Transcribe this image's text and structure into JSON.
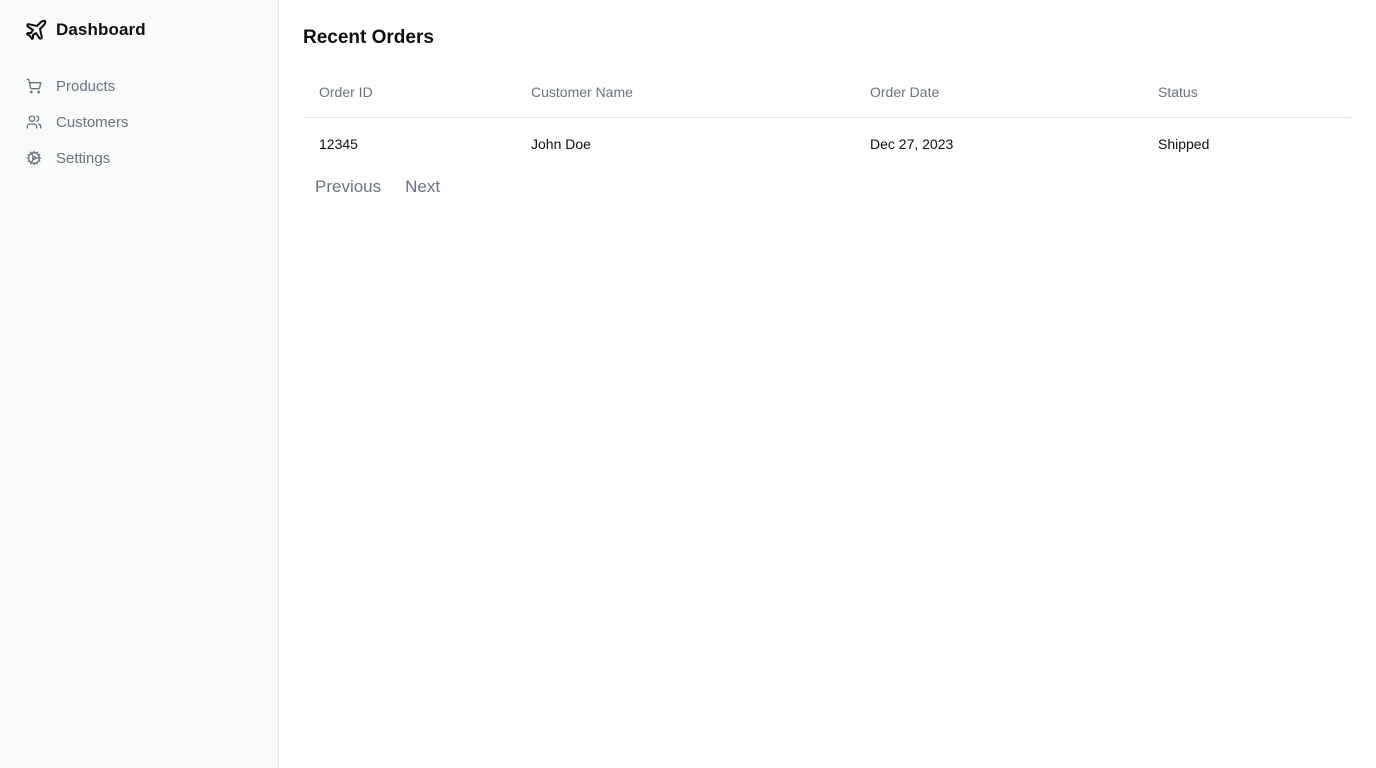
{
  "brand": {
    "title": "Dashboard",
    "icon": "plane-icon"
  },
  "sidebar": {
    "items": [
      {
        "label": "Products",
        "icon": "cart-icon"
      },
      {
        "label": "Customers",
        "icon": "users-icon"
      },
      {
        "label": "Settings",
        "icon": "gear-icon"
      }
    ]
  },
  "main": {
    "title": "Recent Orders",
    "table": {
      "headers": [
        "Order ID",
        "Customer Name",
        "Order Date",
        "Status"
      ],
      "rows": [
        [
          "12345",
          "John Doe",
          "Dec 27, 2023",
          "Shipped"
        ]
      ]
    },
    "pagination": {
      "previous": "Previous",
      "next": "Next"
    }
  },
  "colors": {
    "sidebar_bg": "#f9fafa",
    "muted_text": "#6b7280",
    "text": "#0f0f10",
    "border": "#e5e7eb"
  }
}
